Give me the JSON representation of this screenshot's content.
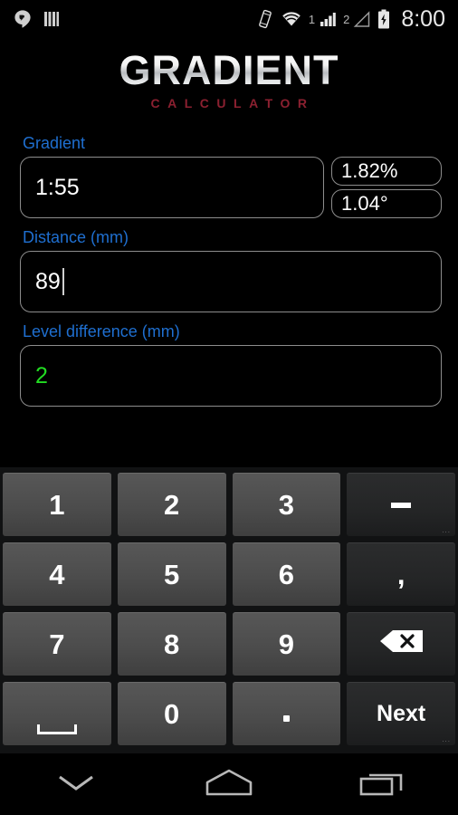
{
  "statusbar": {
    "left_icons": [
      {
        "name": "hangouts-icon",
        "glyph": "quote-bubble"
      },
      {
        "name": "bars-icon",
        "glyph": "vertical-bars"
      }
    ],
    "right_icons": [
      {
        "name": "vibrate-icon",
        "glyph": "phone-vibrate"
      },
      {
        "name": "wifi-icon",
        "glyph": "wifi"
      },
      {
        "name": "sim1-label",
        "glyph": "1"
      },
      {
        "name": "signal-sim1-icon",
        "glyph": "signal-bars"
      },
      {
        "name": "sim2-label",
        "glyph": "2"
      },
      {
        "name": "signal-sim2-icon",
        "glyph": "signal-empty"
      },
      {
        "name": "battery-charging-icon",
        "glyph": "battery-bolt"
      }
    ],
    "sim1_label": "1",
    "sim2_label": "2",
    "clock": "8:00"
  },
  "header": {
    "title": "GRADIENT",
    "subtitle": "CALCULATOR"
  },
  "form": {
    "fields": [
      {
        "label": "Gradient",
        "value": "1:55",
        "has_caret": false,
        "value_color": "#ffffff",
        "side_values": [
          "1.82%",
          "1.04°"
        ]
      },
      {
        "label": "Distance (mm)",
        "value": "89",
        "has_caret": true,
        "value_color": "#ffffff",
        "side_values": []
      },
      {
        "label": "Level difference (mm)",
        "value": "2",
        "has_caret": false,
        "value_color": "#22dd22",
        "side_values": []
      }
    ]
  },
  "keyboard": {
    "rows": [
      [
        {
          "name": "key-1",
          "label": "1",
          "type": "digit"
        },
        {
          "name": "key-2",
          "label": "2",
          "type": "digit"
        },
        {
          "name": "key-3",
          "label": "3",
          "type": "digit"
        },
        {
          "name": "key-minus",
          "label": "-",
          "type": "function",
          "glyph": "minus",
          "hint": "..."
        }
      ],
      [
        {
          "name": "key-4",
          "label": "4",
          "type": "digit"
        },
        {
          "name": "key-5",
          "label": "5",
          "type": "digit"
        },
        {
          "name": "key-6",
          "label": "6",
          "type": "digit"
        },
        {
          "name": "key-comma",
          "label": ",",
          "type": "function"
        }
      ],
      [
        {
          "name": "key-7",
          "label": "7",
          "type": "digit"
        },
        {
          "name": "key-8",
          "label": "8",
          "type": "digit"
        },
        {
          "name": "key-9",
          "label": "9",
          "type": "digit"
        },
        {
          "name": "key-backspace",
          "label": "",
          "type": "function",
          "glyph": "backspace"
        }
      ],
      [
        {
          "name": "key-space",
          "label": "",
          "type": "digit",
          "glyph": "space"
        },
        {
          "name": "key-0",
          "label": "0",
          "type": "digit"
        },
        {
          "name": "key-period",
          "label": ".",
          "type": "digit",
          "glyph": "dot"
        },
        {
          "name": "key-next",
          "label": "Next",
          "type": "function",
          "hint": "..."
        }
      ]
    ]
  },
  "navbar": {
    "buttons": [
      {
        "name": "nav-hide-keyboard-button",
        "glyph": "chevron-down"
      },
      {
        "name": "nav-home-button",
        "glyph": "home"
      },
      {
        "name": "nav-recents-button",
        "glyph": "recents"
      }
    ]
  },
  "colors": {
    "label_blue": "#1f6fd0",
    "subtitle_red": "#8b2030",
    "result_green": "#22dd22",
    "border_gray": "#8d8d8d"
  }
}
